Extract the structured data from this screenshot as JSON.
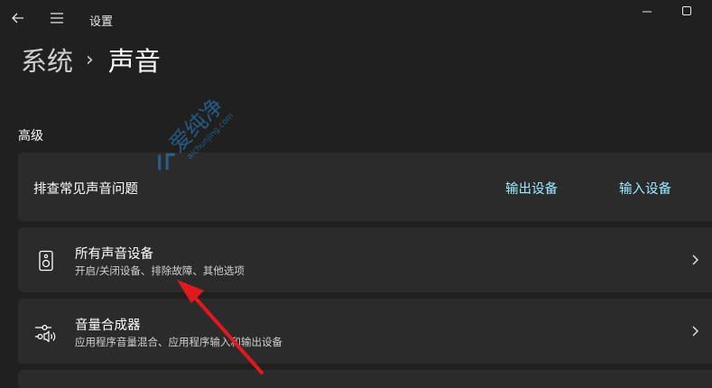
{
  "window": {
    "title": "设置"
  },
  "breadcrumb": {
    "parent": "系统",
    "separator": "›",
    "current": "声音"
  },
  "section": {
    "title": "高级"
  },
  "troubleshoot": {
    "label": "排查常见声音问题",
    "output_link": "输出设备",
    "input_link": "输入设备"
  },
  "rows": [
    {
      "title": "所有声音设备",
      "subtitle": "开启/关闭设备、排除故障、其他选项",
      "icon": "speaker-icon"
    },
    {
      "title": "音量合成器",
      "subtitle": "应用程序音量混合、应用程序输入和输出设备",
      "icon": "mixer-icon"
    }
  ],
  "colors": {
    "background": "#202020",
    "card": "#2b2b2b",
    "accent_link": "#99ebff",
    "annotation_arrow": "#e0191e"
  },
  "watermark": {
    "text_cn": "爱纯净",
    "text_url": "aichunjing.com"
  }
}
